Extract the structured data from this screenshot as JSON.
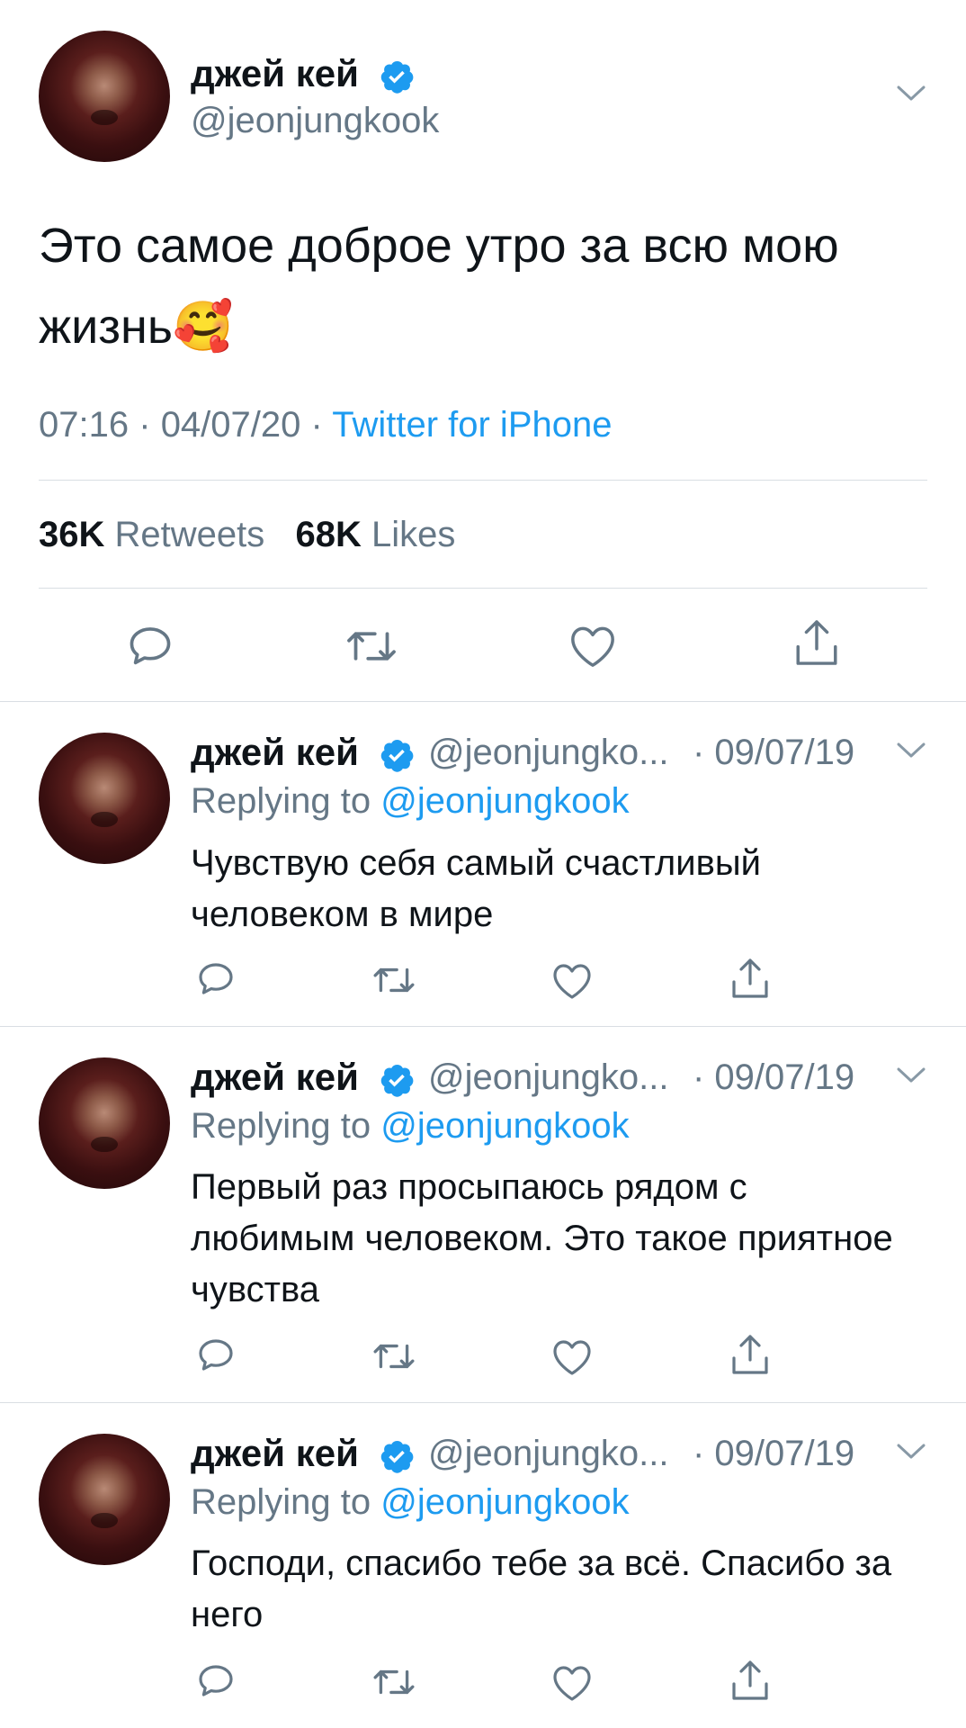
{
  "main_tweet": {
    "author_name": "джей кей",
    "author_handle": "@jeonjungkook",
    "text": "Это самое доброе утро за всю мою жизнь🥰",
    "time": "07:16",
    "date": "04/07/20",
    "source": "Twitter for iPhone",
    "separator": "·",
    "retweets_count": "36K",
    "retweets_label": "Retweets",
    "likes_count": "68K",
    "likes_label": "Likes"
  },
  "replies": [
    {
      "author_name": "джей кей",
      "author_handle": "@jeonjungko...",
      "date": "· 09/07/19",
      "replying_label": "Replying to",
      "replying_to": "@jeonjungkook",
      "text": "Чувствую себя самый счастливый человеком в мире"
    },
    {
      "author_name": "джей кей",
      "author_handle": "@jeonjungko...",
      "date": "· 09/07/19",
      "replying_label": "Replying to",
      "replying_to": "@jeonjungkook",
      "text": "Первый раз просыпаюсь рядом с любимым человеком. Это такое приятное чувства"
    },
    {
      "author_name": "джей кей",
      "author_handle": "@jeonjungko...",
      "date": "· 09/07/19",
      "replying_label": "Replying to",
      "replying_to": "@jeonjungkook",
      "text": "Господи, спасибо тебе за всё. Спасибо за него"
    }
  ],
  "icons": {
    "reply": "reply-icon",
    "retweet": "retweet-icon",
    "like": "heart-icon",
    "share": "share-icon",
    "verified": "verified-badge-icon",
    "more": "chevron-down-icon"
  },
  "colors": {
    "link": "#1d9bf0",
    "secondary_text": "#657786",
    "icon": "#657786",
    "verified": "#1d9bf0",
    "divider": "#d9dee3"
  }
}
